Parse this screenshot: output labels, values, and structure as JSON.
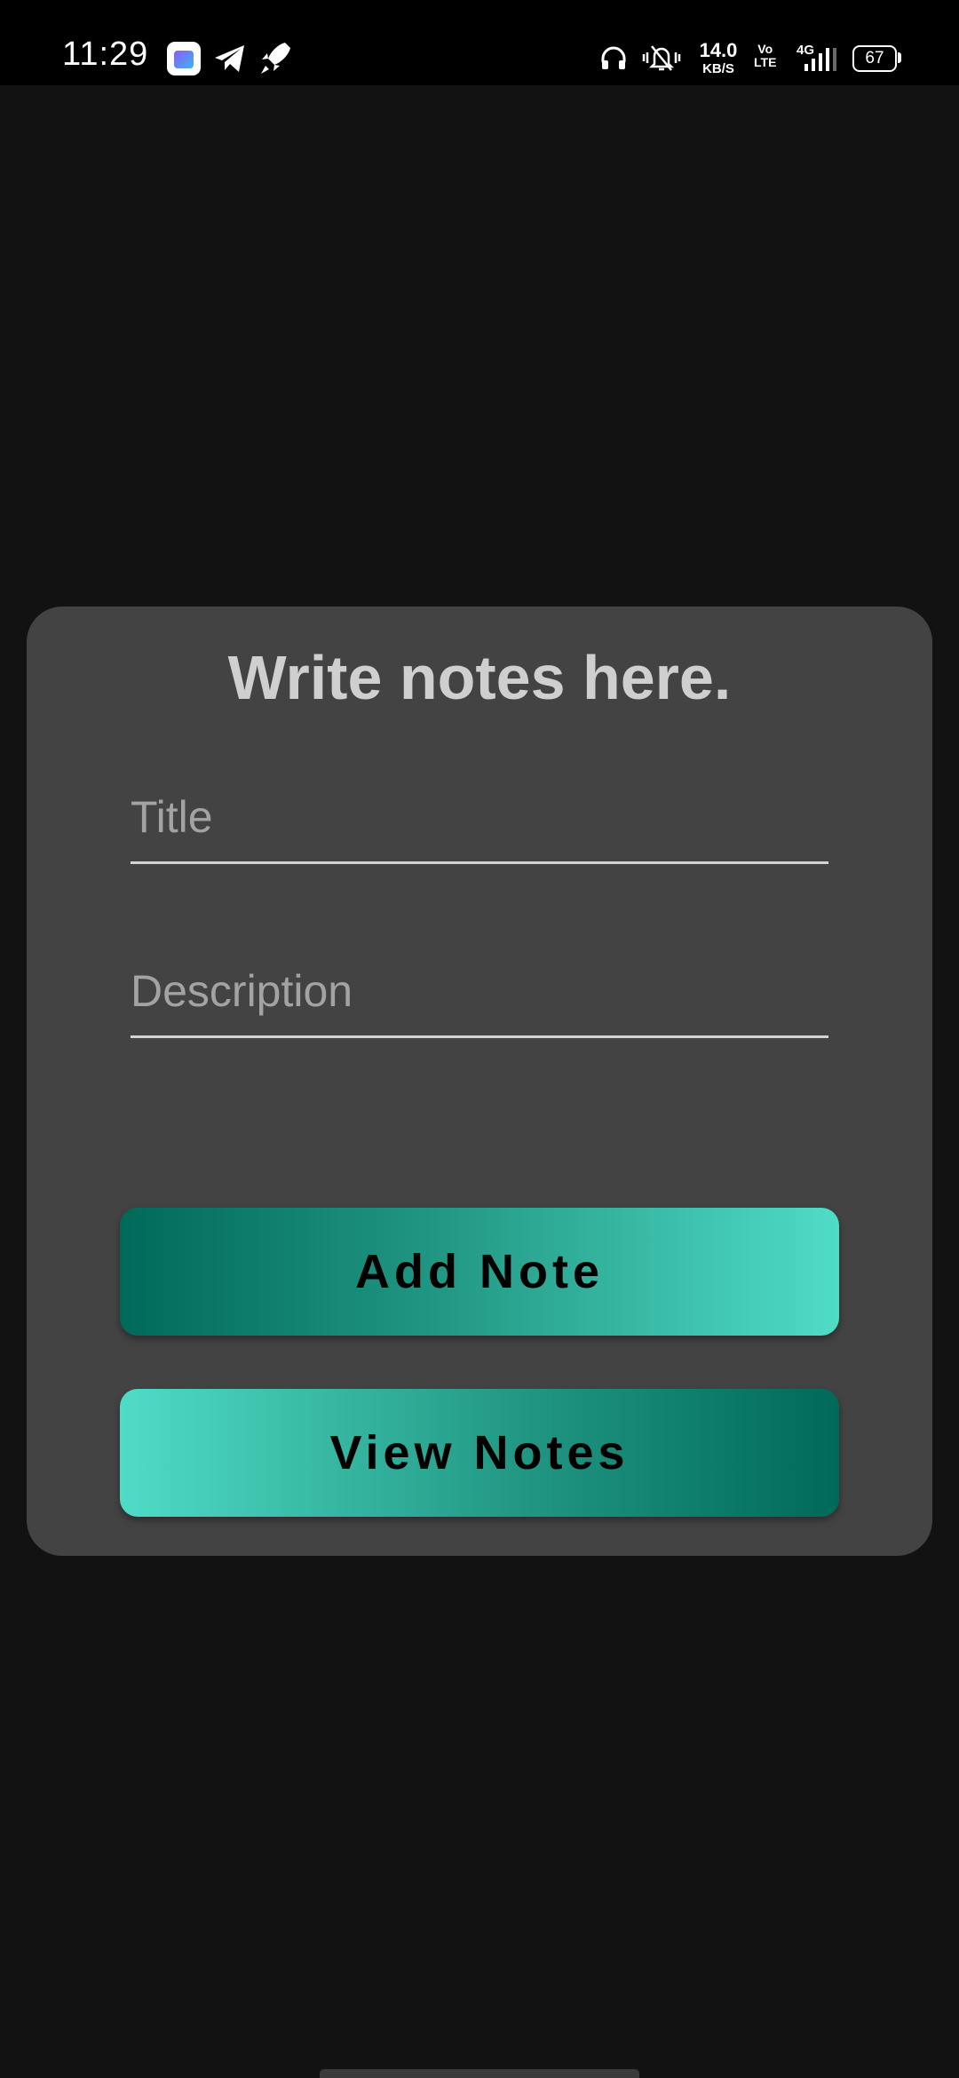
{
  "status_bar": {
    "time": "11:29",
    "net_speed_value": "14.0",
    "net_speed_unit": "KB/S",
    "volte_top": "Vo",
    "volte_bottom": "LTE",
    "network_type": "4G",
    "battery_level": "67",
    "notification_icons": [
      "store-app-icon",
      "telegram-icon",
      "rocket-icon"
    ],
    "system_icons": [
      "headphones-icon",
      "silent-bell-icon",
      "signal-icon",
      "battery-icon"
    ]
  },
  "card": {
    "title": "Write notes here.",
    "title_field_placeholder": "Title",
    "description_field_placeholder": "Description",
    "add_note_label": "Add Note",
    "view_notes_label": "View Notes"
  },
  "colors": {
    "background": "#121212",
    "card": "#434343",
    "accent_dark": "#00695a",
    "accent_light": "#4fdcc6",
    "title_text": "#cfcfcf"
  }
}
